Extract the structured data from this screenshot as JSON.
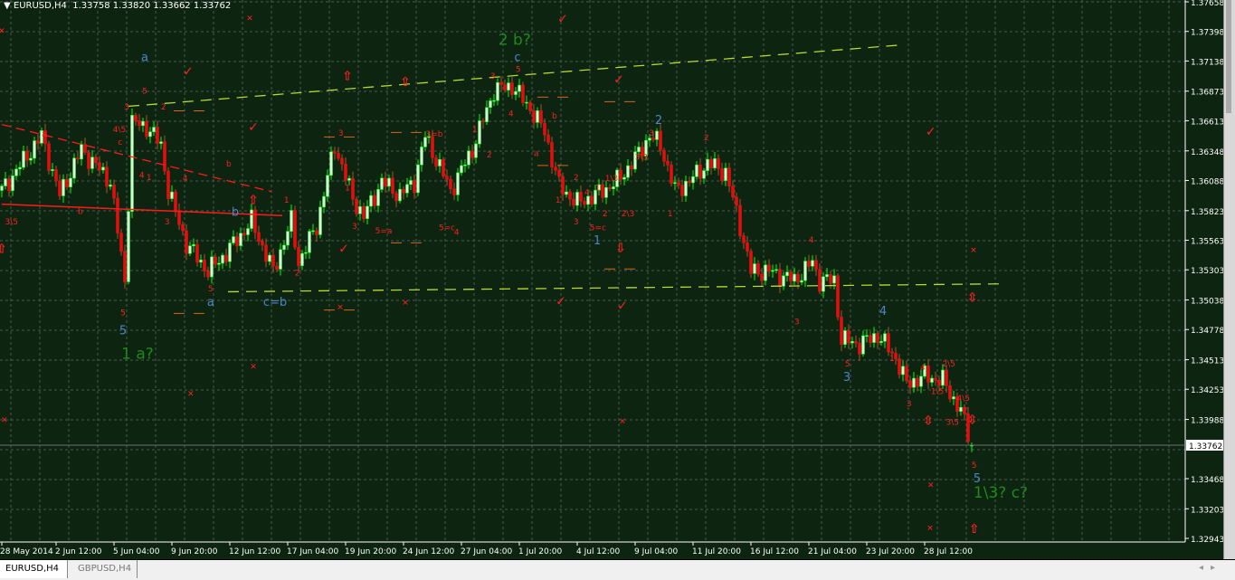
{
  "header": {
    "symbol": "EURUSD,H4",
    "quote": "1.33758 1.33820 1.33662 1.33762"
  },
  "tabs": [
    {
      "label": "EURUSD,H4",
      "active": true
    },
    {
      "label": "GBPUSD,H4",
      "active": false
    }
  ],
  "colors": {
    "background": "#0c2410",
    "bull_wick": "#00ff00",
    "bull_body": "#ffffff",
    "bear_body": "#e01010",
    "bear_wick": "#b0541e",
    "trendline": "#b8d832",
    "red_line": "#ff1a1a",
    "orange_level": "#d8641e",
    "wave_blue": "#4a86c8",
    "wave_green": "#1e8a1e",
    "wave_red": "#ff2020"
  },
  "chart_data": {
    "type": "candlestick",
    "title": "EURUSD,H4",
    "ohlc_last": {
      "open": 1.33758,
      "high": 1.3382,
      "low": 1.33662,
      "close": 1.33762
    },
    "current_price_label": "1.33762",
    "y_ticks": [
      "1.37658",
      "1.37398",
      "1.37138",
      "1.36873",
      "1.36613",
      "1.36348",
      "1.36088",
      "1.35823",
      "1.35563",
      "1.35303",
      "1.35038",
      "1.34778",
      "1.34513",
      "1.34253",
      "1.33988",
      "1.33468",
      "1.33203",
      "1.32943"
    ],
    "ylim": [
      1.32943,
      1.37658
    ],
    "x_ticks": [
      {
        "bar": 0,
        "label": "28 May 2014"
      },
      {
        "bar": 15,
        "label": "2 Jun 12:00"
      },
      {
        "bar": 31,
        "label": "5 Jun 04:00"
      },
      {
        "bar": 47,
        "label": "9 Jun 20:00"
      },
      {
        "bar": 63,
        "label": "12 Jun 12:00"
      },
      {
        "bar": 79,
        "label": "17 Jun 04:00"
      },
      {
        "bar": 95,
        "label": "19 Jun 20:00"
      },
      {
        "bar": 111,
        "label": "24 Jun 12:00"
      },
      {
        "bar": 127,
        "label": "27 Jun 04:00"
      },
      {
        "bar": 143,
        "label": "1 Jul 20:00"
      },
      {
        "bar": 159,
        "label": "4 Jul 12:00"
      },
      {
        "bar": 175,
        "label": "9 Jul 04:00"
      },
      {
        "bar": 191,
        "label": "11 Jul 20:00"
      },
      {
        "bar": 207,
        "label": "16 Jul 12:00"
      },
      {
        "bar": 223,
        "label": "21 Jul 04:00"
      },
      {
        "bar": 239,
        "label": "23 Jul 20:00"
      },
      {
        "bar": 255,
        "label": "28 Jul 12:00"
      }
    ],
    "close_path": [
      [
        0,
        1.36
      ],
      [
        11,
        1.3648
      ],
      [
        16,
        1.3596
      ],
      [
        22,
        1.3636
      ],
      [
        30,
        1.3608
      ],
      [
        34,
        1.3521
      ],
      [
        36,
        1.366
      ],
      [
        40,
        1.3656
      ],
      [
        44,
        1.364
      ],
      [
        46,
        1.36
      ],
      [
        51,
        1.3553
      ],
      [
        57,
        1.3529
      ],
      [
        62,
        1.3545
      ],
      [
        69,
        1.3573
      ],
      [
        75,
        1.3529
      ],
      [
        80,
        1.3573
      ],
      [
        82,
        1.3537
      ],
      [
        87,
        1.3569
      ],
      [
        92,
        1.364
      ],
      [
        97,
        1.3593
      ],
      [
        100,
        1.3577
      ],
      [
        105,
        1.3608
      ],
      [
        110,
        1.3596
      ],
      [
        114,
        1.3608
      ],
      [
        117,
        1.3648
      ],
      [
        124,
        1.36
      ],
      [
        130,
        1.3636
      ],
      [
        136,
        1.3688
      ],
      [
        141,
        1.3692
      ],
      [
        146,
        1.3672
      ],
      [
        150,
        1.3652
      ],
      [
        154,
        1.3604
      ],
      [
        159,
        1.3589
      ],
      [
        164,
        1.3596
      ],
      [
        170,
        1.3608
      ],
      [
        175,
        1.3628
      ],
      [
        179,
        1.3648
      ],
      [
        182,
        1.364
      ],
      [
        186,
        1.36
      ],
      [
        190,
        1.3608
      ],
      [
        195,
        1.3624
      ],
      [
        200,
        1.3616
      ],
      [
        204,
        1.3569
      ],
      [
        207,
        1.3529
      ],
      [
        212,
        1.3529
      ],
      [
        219,
        1.3521
      ],
      [
        224,
        1.3537
      ],
      [
        226,
        1.3521
      ],
      [
        230,
        1.3521
      ],
      [
        232,
        1.3469
      ],
      [
        237,
        1.3465
      ],
      [
        242,
        1.3473
      ],
      [
        247,
        1.3453
      ],
      [
        250,
        1.343
      ],
      [
        255,
        1.3437
      ],
      [
        260,
        1.3433
      ],
      [
        265,
        1.3406
      ],
      [
        268,
        1.33762
      ]
    ],
    "trendlines": [
      {
        "kind": "dashed-yellow",
        "from": [
          35,
          1.3674
        ],
        "to": [
          249,
          1.3728
        ]
      },
      {
        "kind": "dashed-yellow",
        "from": [
          62.5,
          1.3511
        ],
        "to": [
          277,
          1.3518
        ]
      },
      {
        "kind": "dashed-red",
        "from": [
          0,
          1.3658
        ],
        "to": [
          74.5,
          1.3599
        ]
      },
      {
        "kind": "solid-red",
        "from": [
          0,
          1.3588
        ],
        "to": [
          77.5,
          1.3578
        ]
      }
    ],
    "levels": [
      [
        47.5,
        56.5,
        1.367
      ],
      [
        47.5,
        56.5,
        1.3492
      ],
      [
        89,
        97.5,
        1.3647
      ],
      [
        107.5,
        116,
        1.3651
      ],
      [
        107.5,
        116,
        1.3554
      ],
      [
        89,
        98,
        1.3495
      ],
      [
        148,
        157.5,
        1.3682
      ],
      [
        148,
        157.5,
        1.3622
      ],
      [
        166.5,
        175.5,
        1.3678
      ],
      [
        166.5,
        175.5,
        1.3531
      ]
    ],
    "annotations": [
      [
        "2  b?",
        141.7,
        1.3734,
        "g"
      ],
      [
        "1    a?",
        37.5,
        1.3458,
        "g"
      ],
      [
        "1\\3?  c?",
        276,
        1.3336,
        "g"
      ],
      [
        "c",
        142.5,
        1.3718,
        "b"
      ],
      [
        "a",
        39.5,
        1.3718,
        "b"
      ],
      [
        "5",
        33.5,
        1.3478,
        "b"
      ],
      [
        "a",
        57.7,
        1.3503,
        "b"
      ],
      [
        "c=b",
        75.5,
        1.3503,
        "b"
      ],
      [
        "b",
        64.5,
        1.3582,
        "b"
      ],
      [
        "1",
        164.5,
        1.3557,
        "b"
      ],
      [
        "2",
        181.5,
        1.3663,
        "b"
      ],
      [
        "3",
        233.5,
        1.3437,
        "b"
      ],
      [
        "4",
        243.5,
        1.3495,
        "b"
      ],
      [
        "5",
        269.5,
        1.3348,
        "b"
      ],
      [
        "5",
        39.5,
        1.3688,
        "r"
      ],
      [
        "3",
        34.5,
        1.3674,
        "r"
      ],
      [
        "2",
        44.7,
        1.3674,
        "r"
      ],
      [
        "4\\5",
        32.5,
        1.3654,
        "r"
      ],
      [
        "c",
        32.7,
        1.3643,
        "r"
      ],
      [
        "a",
        11.7,
        1.365,
        "r"
      ],
      [
        "b",
        21.7,
        1.3582,
        "r"
      ],
      [
        "3\\5",
        2.7,
        1.3573,
        "r"
      ],
      [
        "4",
        38.7,
        1.3614,
        "r"
      ],
      [
        "1",
        40.7,
        1.3612,
        "r"
      ],
      [
        "4",
        50.7,
        1.3611,
        "r"
      ],
      [
        "3",
        45.7,
        1.3573,
        "r"
      ],
      [
        "b",
        62.7,
        1.3624,
        "r"
      ],
      [
        "5",
        57.7,
        1.3514,
        "r"
      ],
      [
        "2",
        81.7,
        1.3528,
        "r"
      ],
      [
        "1",
        78.7,
        1.3592,
        "r"
      ],
      [
        "5",
        33.5,
        1.3493,
        "r"
      ],
      [
        "3",
        93.7,
        1.3651,
        "r"
      ],
      [
        "1",
        95.5,
        1.3603,
        "r"
      ],
      [
        "3",
        97.5,
        1.3569,
        "r"
      ],
      [
        "5=a",
        105.5,
        1.3565,
        "r"
      ],
      [
        "3=b",
        119.5,
        1.365,
        "r"
      ],
      [
        "5=c",
        123,
        1.3568,
        "r"
      ],
      [
        "4",
        125.7,
        1.3564,
        "r"
      ],
      [
        "1",
        130.7,
        1.3654,
        "r"
      ],
      [
        "2",
        134.7,
        1.3632,
        "r"
      ],
      [
        "3",
        135.7,
        1.3701,
        "r"
      ],
      [
        "5",
        142.7,
        1.3707,
        "r"
      ],
      [
        "4",
        140.7,
        1.3668,
        "r"
      ],
      [
        "b",
        152.7,
        1.3666,
        "r"
      ],
      [
        "a",
        147.7,
        1.3633,
        "r"
      ],
      [
        "2",
        158.7,
        1.3612,
        "r"
      ],
      [
        "1",
        153.7,
        1.3592,
        "r"
      ],
      [
        "3",
        158.7,
        1.3573,
        "r"
      ],
      [
        "4",
        161.7,
        1.3599,
        "r"
      ],
      [
        "1",
        164.7,
        1.3603,
        "r"
      ],
      [
        "1\\3",
        168.5,
        1.3611,
        "r"
      ],
      [
        "5=c",
        164.7,
        1.3568,
        "r"
      ],
      [
        "2",
        166.7,
        1.358,
        "r"
      ],
      [
        "2\\3",
        173,
        1.358,
        "r"
      ],
      [
        "3\\3",
        176.7,
        1.363,
        "r"
      ],
      [
        "3",
        179.5,
        1.3651,
        "r"
      ],
      [
        "1",
        184.7,
        1.358,
        "r"
      ],
      [
        "2",
        194.7,
        1.3647,
        "r"
      ],
      [
        "4",
        223.7,
        1.3557,
        "r"
      ],
      [
        "3",
        219.7,
        1.3485,
        "r"
      ],
      [
        "5",
        233.7,
        1.3448,
        "r"
      ],
      [
        "1",
        246,
        1.3453,
        "r"
      ],
      [
        "3",
        250.7,
        1.3413,
        "r"
      ],
      [
        "4",
        254.5,
        1.3445,
        "r"
      ],
      [
        "1\\5",
        258.5,
        1.3424,
        "r"
      ],
      [
        "2\\5",
        261.7,
        1.3448,
        "r"
      ],
      [
        "4\\5",
        265.7,
        1.3418,
        "r"
      ],
      [
        "3\\5",
        262.7,
        1.3397,
        "r"
      ],
      [
        "5",
        268.7,
        1.3359,
        "r"
      ]
    ],
    "markers": [
      [
        "check",
        155,
        1.3751
      ],
      [
        "check",
        51.5,
        1.3705
      ],
      [
        "check",
        69.5,
        1.3656
      ],
      [
        "check",
        170.5,
        1.3698
      ],
      [
        "check",
        256.7,
        1.3652
      ],
      [
        "check",
        94.5,
        1.3549
      ],
      [
        "check",
        154.5,
        1.3503
      ],
      [
        "check",
        171.5,
        1.3499
      ],
      [
        "cross",
        68.5,
        1.3753
      ],
      [
        "cross",
        0,
        1.3742
      ],
      [
        "cross",
        111.5,
        1.3503
      ],
      [
        "cross",
        93.5,
        1.3499
      ],
      [
        "cross",
        69.5,
        1.3447
      ],
      [
        "cross",
        52.2,
        1.3423
      ],
      [
        "cross",
        0.7,
        1.34
      ],
      [
        "cross",
        171.5,
        1.3399
      ],
      [
        "cross",
        268.5,
        1.3549
      ],
      [
        "cross",
        256.7,
        1.3343
      ],
      [
        "cross",
        256.5,
        1.3305
      ],
      [
        "up",
        95.5,
        1.3701
      ],
      [
        "up",
        111.5,
        1.3696
      ],
      [
        "up",
        69.5,
        1.3592
      ],
      [
        "up",
        0,
        1.3549
      ],
      [
        "up",
        268.7,
        1.3303
      ],
      [
        "down",
        171,
        1.355
      ],
      [
        "updown",
        268.2,
        1.3506
      ],
      [
        "updown",
        256,
        1.3398
      ],
      [
        "updown",
        268.2,
        1.3399
      ]
    ]
  }
}
